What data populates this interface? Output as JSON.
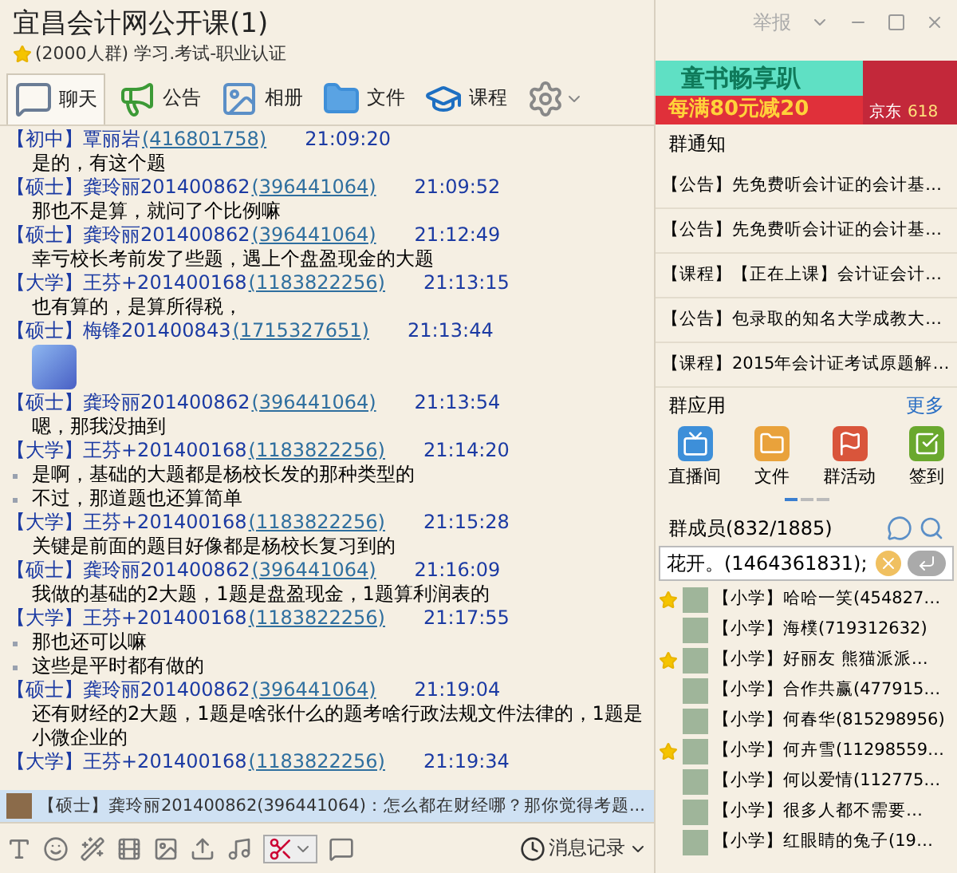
{
  "window": {
    "title": "宜昌会计网公开课(1)",
    "subtitle": "(2000人群) 学习.考试-职业认证",
    "report": "举报"
  },
  "tabs": [
    {
      "label": "聊天",
      "selected": true
    },
    {
      "label": "公告",
      "selected": false
    },
    {
      "label": "相册",
      "selected": false
    },
    {
      "label": "文件",
      "selected": false
    },
    {
      "label": "课程",
      "selected": false
    }
  ],
  "messages": [
    {
      "rank": "【初中】",
      "name": "覃丽岩",
      "qq": "(416801758)",
      "time": "21:09:20",
      "lines": [
        "是的，有这个题"
      ]
    },
    {
      "rank": "【硕士】",
      "name": "龚玲丽201400862",
      "qq": "(396441064)",
      "time": "21:09:52",
      "lines": [
        "那也不是算，就问了个比例嘛"
      ]
    },
    {
      "rank": "【硕士】",
      "name": "龚玲丽201400862",
      "qq": "(396441064)",
      "time": "21:12:49",
      "lines": [
        "幸亏校长考前发了些题，遇上个盘盈现金的大题"
      ]
    },
    {
      "rank": "【大学】",
      "name": "王芬+201400168",
      "qq": "(1183822256)",
      "time": "21:13:15",
      "lines": [
        "也有算的，是算所得税，"
      ]
    },
    {
      "rank": "【硕士】",
      "name": "梅锋201400843",
      "qq": "(1715327651)",
      "time": "21:13:44",
      "kind": "sticker"
    },
    {
      "rank": "【硕士】",
      "name": "龚玲丽201400862",
      "qq": "(396441064)",
      "time": "21:13:54",
      "lines": [
        "嗯，那我没抽到"
      ]
    },
    {
      "rank": "【大学】",
      "name": "王芬+201400168",
      "qq": "(1183822256)",
      "time": "21:14:20",
      "bulleted": true,
      "lines": [
        "是啊，基础的大题都是杨校长发的那种类型的",
        "不过，那道题也还算简单"
      ]
    },
    {
      "rank": "【大学】",
      "name": "王芬+201400168",
      "qq": "(1183822256)",
      "time": "21:15:28",
      "lines": [
        "关键是前面的题目好像都是杨校长复习到的"
      ]
    },
    {
      "rank": "【硕士】",
      "name": "龚玲丽201400862",
      "qq": "(396441064)",
      "time": "21:16:09",
      "lines": [
        "我做的基础的2大题，1题是盘盈现金，1题算利润表的"
      ]
    },
    {
      "rank": "【大学】",
      "name": "王芬+201400168",
      "qq": "(1183822256)",
      "time": "21:17:55",
      "bulleted": true,
      "lines": [
        "那也还可以嘛",
        "这些是平时都有做的"
      ]
    },
    {
      "rank": "【硕士】",
      "name": "龚玲丽201400862",
      "qq": "(396441064)",
      "time": "21:19:04",
      "lines": [
        "还有财经的2大题，1题是啥张什么的题考啥行政法规文件法律的，1题是小微企业的"
      ]
    },
    {
      "rank": "【大学】",
      "name": "王芬+201400168",
      "qq": "(1183822256)",
      "time": "21:19:34"
    }
  ],
  "new_message_bar": {
    "text": "【硕士】龚玲丽201400862(396441064)：怎么都在财经哪？那你觉得考题..."
  },
  "input_toolbar": {
    "history": "消息记录"
  },
  "ad": {
    "headline": "童书畅享趴",
    "offer": "每满80元减20",
    "brand": "京东",
    "tag": "618"
  },
  "notices": {
    "title": "群通知",
    "items": [
      "【公告】先免费听会计证的会计基…",
      "【公告】先免费听会计证的会计基…",
      "【课程】【正在上课】会计证会计…",
      "【公告】包录取的知名大学成教大…",
      "【课程】2015年会计证考试原题解…"
    ]
  },
  "apps": {
    "title": "群应用",
    "more": "更多",
    "items": [
      {
        "label": "直播间",
        "kind": "live",
        "color": "#3d8fd9"
      },
      {
        "label": "文件",
        "kind": "file",
        "color": "#e9a23b"
      },
      {
        "label": "群活动",
        "kind": "event",
        "color": "#d9553b"
      },
      {
        "label": "签到",
        "kind": "checkin",
        "color": "#6aa82e"
      }
    ]
  },
  "members": {
    "title": "群成员(832/1885)",
    "search_value": "花开。(1464361831);",
    "items": [
      {
        "text": "【小学】哈哈一笑(454827…",
        "starred": true
      },
      {
        "text": "【小学】海樸(719312632)",
        "starred": false
      },
      {
        "text": "【小学】好丽友 熊猫派派…",
        "starred": true
      },
      {
        "text": "【小学】合作共赢(477915…",
        "starred": false
      },
      {
        "text": "【小学】何春华(815298956)",
        "starred": false
      },
      {
        "text": "【小学】何卉雪(11298559…",
        "starred": true
      },
      {
        "text": "【小学】何以爱情(112775…",
        "starred": false
      },
      {
        "text": "【小学】很多人都不需要…",
        "starred": false
      },
      {
        "text": "【小学】红眼睛的兔子(19…",
        "starred": false
      }
    ]
  }
}
